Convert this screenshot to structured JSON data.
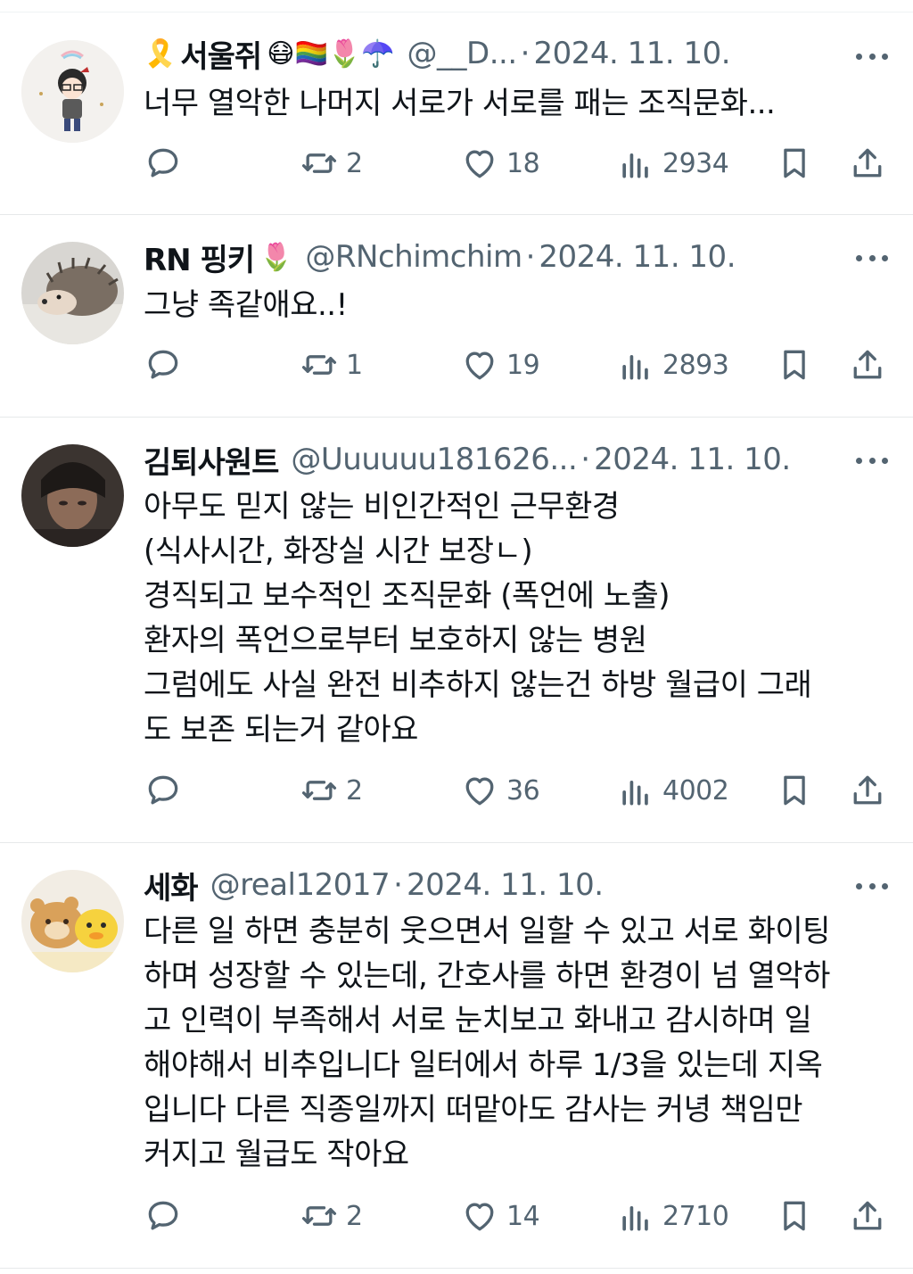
{
  "tweets": [
    {
      "name": "서울쥐",
      "name_prefix_emoji": "🎗️",
      "emojis": "😷🏳️‍🌈🌷☂️",
      "handle": "@__D...",
      "sep": "·",
      "date": "2024. 11. 10.",
      "text": "너무 열악한 나머지 서로가 서로를 패는 조직문화...",
      "retweets": "2",
      "likes": "18",
      "views": "2934"
    },
    {
      "name": "RN 핑키",
      "emojis": "🌷",
      "handle": "@RNchimchim",
      "sep": "·",
      "date": "2024. 11. 10.",
      "text": "그냥 족같애요..!",
      "retweets": "1",
      "likes": "19",
      "views": "2893"
    },
    {
      "name": "김퇴사원트",
      "emojis": "",
      "handle": "@Uuuuuu181626...",
      "sep": "·",
      "date": "2024. 11. 10.",
      "text": "아무도 믿지 않는 비인간적인 근무환경\n(식사시간, 화장실 시간 보장ㄴ)\n경직되고 보수적인 조직문화 (폭언에 노출)\n환자의 폭언으로부터 보호하지 않는 병원\n그럼에도 사실 완전 비추하지 않는건 하방 월급이 그래\n도 보존 되는거 같아요",
      "retweets": "2",
      "likes": "36",
      "views": "4002"
    },
    {
      "name": "세화",
      "emojis": "",
      "handle": "@real12017",
      "sep": "·",
      "date": "2024. 11. 10.",
      "text": "다른 일 하면 충분히 웃으면서 일할 수 있고 서로 화이팅\n하며 성장할 수 있는데, 간호사를 하면 환경이 넘 열악하\n고 인력이 부족해서 서로 눈치보고 화내고 감시하며 일\n해야해서 비추입니다 일터에서 하루 1/3을 있는데 지옥\n입니다 다른 직종일까지 떠맡아도 감사는 커녕 책임만\n커지고 월급도 작아요",
      "retweets": "2",
      "likes": "14",
      "views": "2710"
    }
  ],
  "icons": {
    "reply": "reply-icon",
    "retweet": "retweet-icon",
    "like": "heart-icon",
    "views": "views-icon",
    "bookmark": "bookmark-icon",
    "share": "share-icon",
    "more": "more-icon"
  }
}
